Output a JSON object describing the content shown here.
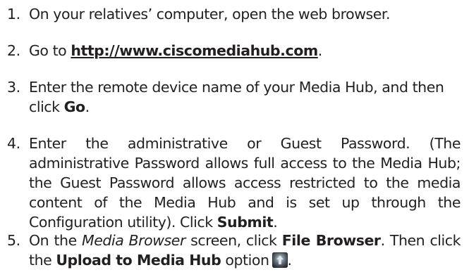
{
  "steps": [
    {
      "number": "1.",
      "text": "On your relatives’ computer, open the web browser."
    },
    {
      "number": "2.",
      "prefix": "Go to ",
      "link": "http://www.ciscomediahub.com",
      "suffix": "."
    },
    {
      "number": "3.",
      "prefix": "Enter the remote device name of your Media Hub, and then click ",
      "bold": "Go",
      "suffix": "."
    },
    {
      "number": "4.",
      "prefix": "Enter the administrative or Guest Password. (The administrative Password allows full access to the Media Hub; the Guest Password allows access restricted to the media content of the Media Hub and is set up through the Configuration utility). Click ",
      "bold": "Submit",
      "suffix": "."
    },
    {
      "number": "5.",
      "part1": "On the ",
      "italic": "Media Browser",
      "part2": " screen, click ",
      "bold1": "File Browser",
      "part3": ". Then click the ",
      "bold2": "Upload to Media Hub",
      "part4": " option",
      "icon": "upload-to-media-hub-icon",
      "end": "."
    }
  ]
}
